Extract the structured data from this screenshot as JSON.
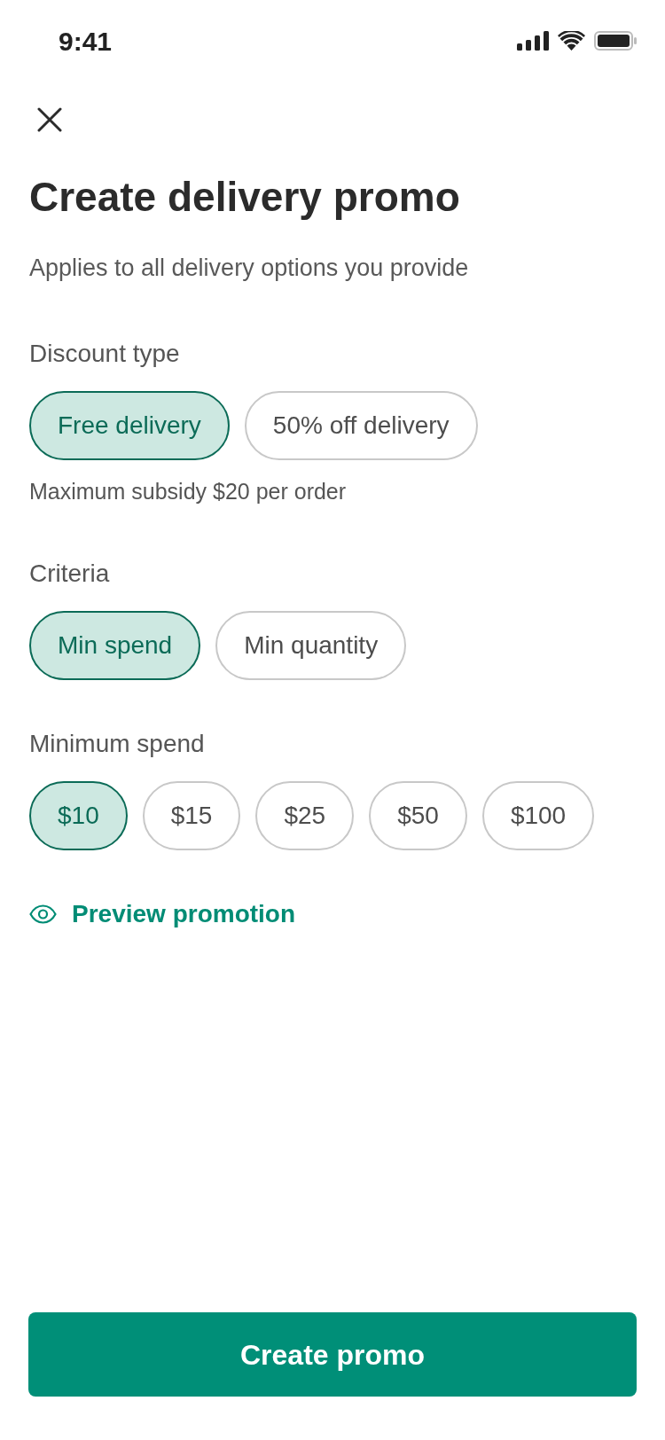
{
  "status_bar": {
    "time": "9:41"
  },
  "header": {
    "title": "Create delivery promo",
    "subtitle": "Applies to all delivery options you provide"
  },
  "sections": [
    {
      "label": "Discount type",
      "options": [
        {
          "label": "Free delivery",
          "selected": true
        },
        {
          "label": "50% off delivery",
          "selected": false
        }
      ],
      "note": "Maximum subsidy $20 per order"
    },
    {
      "label": "Criteria",
      "options": [
        {
          "label": "Min spend",
          "selected": true
        },
        {
          "label": "Min quantity",
          "selected": false
        }
      ]
    },
    {
      "label": "Minimum spend",
      "options": [
        {
          "label": "$10",
          "selected": true
        },
        {
          "label": "$15",
          "selected": false
        },
        {
          "label": "$25",
          "selected": false
        },
        {
          "label": "$50",
          "selected": false
        },
        {
          "label": "$100",
          "selected": false
        }
      ]
    }
  ],
  "preview_link": {
    "label": "Preview promotion"
  },
  "primary_button": {
    "label": "Create promo"
  }
}
